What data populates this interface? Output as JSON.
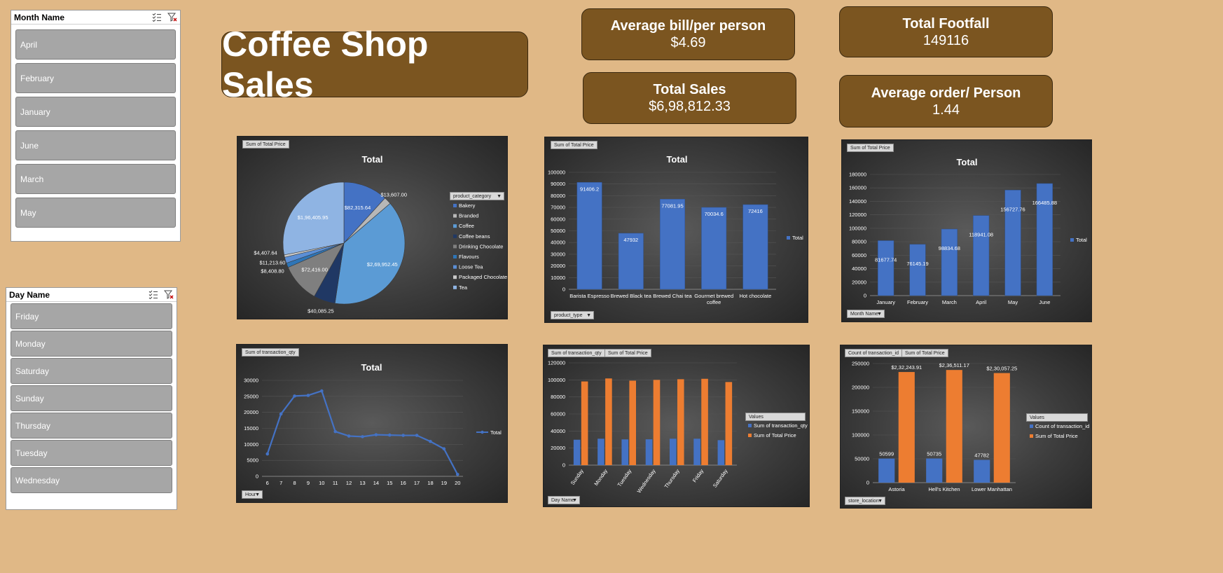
{
  "month_slicer": {
    "title": "Month Name",
    "items": [
      "April",
      "February",
      "January",
      "June",
      "March",
      "May"
    ]
  },
  "day_slicer": {
    "title": "Day Name",
    "items": [
      "Friday",
      "Monday",
      "Saturday",
      "Sunday",
      "Thursday",
      "Tuesday",
      "Wednesday"
    ]
  },
  "page_title": "Coffee Shop Sales",
  "kpis": {
    "avg_bill": {
      "label": "Average bill/per person",
      "value": "$4.69"
    },
    "total_sales": {
      "label": "Total Sales",
      "value": "$6,98,812.33"
    },
    "total_footfall": {
      "label": "Total Footfall",
      "value": "149116"
    },
    "avg_order": {
      "label": "Average order/ Person",
      "value": "1.44"
    }
  },
  "colors": {
    "blue": "#4472c4",
    "orange": "#ed7d31",
    "card": "#7b5520",
    "background": "#e0b886"
  },
  "chart_data": [
    {
      "type": "pie",
      "title": "Total",
      "field_buttons": [
        "Sum of Total Price"
      ],
      "legend_title": "product_category",
      "legend_position": "right",
      "categories": [
        "Bakery",
        "Branded",
        "Coffee",
        "Coffee beans",
        "Drinking Chocolate",
        "Flavours",
        "Loose Tea",
        "Packaged Chocolate",
        "Tea"
      ],
      "values": [
        82315.64,
        13607.0,
        269952.45,
        40085.25,
        72416.0,
        8408.8,
        11213.6,
        4407.64,
        196405.95
      ],
      "data_labels": [
        "$82,315.64",
        "$13,607.00",
        "$2,69,952.45",
        "$40,085.25",
        "$72,416.00",
        "$8,408.80",
        "$11,213.60",
        "$4,407.64",
        "$1,96,405.95"
      ],
      "slice_colors": [
        "#4472c4",
        "#b7b7b7",
        "#5b9bd5",
        "#203864",
        "#7f7f7f",
        "#2e75b6",
        "#5b8fd6",
        "#c9c9c9",
        "#8fb4e3"
      ]
    },
    {
      "type": "bar",
      "title": "Total",
      "field_buttons": [
        "Sum of Total Price"
      ],
      "axis_button": "product_type",
      "categories": [
        "Barista Espresso",
        "Brewed Black tea",
        "Brewed Chai tea",
        "Gourmet brewed coffee",
        "Hot chocolate"
      ],
      "values": [
        91406.2,
        47932,
        77081.95,
        70034.6,
        72416
      ],
      "data_labels": [
        "91406.2",
        "47932",
        "77081.95",
        "70034.6",
        "72416"
      ],
      "yticks": [
        "0",
        "10000",
        "20000",
        "30000",
        "40000",
        "50000",
        "60000",
        "70000",
        "80000",
        "90000",
        "100000"
      ],
      "ylim": [
        0,
        100000
      ],
      "legend": [
        "Total"
      ],
      "legend_position": "right"
    },
    {
      "type": "bar",
      "title": "Total",
      "field_buttons": [
        "Sum of Total Price"
      ],
      "axis_button": "Month Name",
      "categories": [
        "January",
        "February",
        "March",
        "April",
        "May",
        "June"
      ],
      "values": [
        81677.74,
        76145.19,
        98834.68,
        118941.08,
        156727.76,
        166485.88
      ],
      "data_labels": [
        "81677.74",
        "76145.19",
        "98834.68",
        "118941.08",
        "156727.76",
        "166485.88"
      ],
      "yticks": [
        "0",
        "20000",
        "40000",
        "60000",
        "80000",
        "100000",
        "120000",
        "140000",
        "160000",
        "180000"
      ],
      "ylim": [
        0,
        180000
      ],
      "legend": [
        "Total"
      ],
      "legend_position": "right"
    },
    {
      "type": "line",
      "title": "Total",
      "field_buttons": [
        "Sum of transaction_qty"
      ],
      "axis_button": "Hour",
      "x": [
        "6",
        "7",
        "8",
        "9",
        "10",
        "11",
        "12",
        "13",
        "14",
        "15",
        "16",
        "17",
        "18",
        "19",
        "20"
      ],
      "values": [
        7000,
        19500,
        25100,
        25300,
        26700,
        14000,
        12600,
        12400,
        13000,
        12900,
        12800,
        12800,
        10900,
        8600,
        600
      ],
      "yticks": [
        "0",
        "5000",
        "10000",
        "15000",
        "20000",
        "25000",
        "30000"
      ],
      "ylim": [
        0,
        30000
      ],
      "legend": [
        "Total"
      ],
      "legend_position": "right"
    },
    {
      "type": "bar",
      "field_buttons": [
        "Sum of transaction_qty",
        "Sum of Total Price"
      ],
      "axis_button": "Day Name",
      "categories": [
        "Sunday",
        "Monday",
        "Tuesday",
        "Wednesday",
        "Thursday",
        "Friday",
        "Saturday"
      ],
      "series": [
        {
          "name": "Sum of transaction_qty",
          "values": [
            29800,
            31000,
            30200,
            30300,
            31000,
            31000,
            29300
          ]
        },
        {
          "name": "Sum of Total Price",
          "values": [
            98200,
            101700,
            99100,
            100000,
            100800,
            101300,
            97500
          ]
        }
      ],
      "yticks": [
        "0",
        "20000",
        "40000",
        "60000",
        "80000",
        "100000",
        "120000"
      ],
      "ylim": [
        0,
        120000
      ],
      "legend_title": "Values",
      "legend_position": "right"
    },
    {
      "type": "bar",
      "field_buttons": [
        "Count of transaction_id",
        "Sum of Total Price"
      ],
      "axis_button": "store_location",
      "categories": [
        "Astoria",
        "Hell's Kitchen",
        "Lower Manhattan"
      ],
      "series": [
        {
          "name": "Count of transaction_id",
          "values": [
            50599,
            50735,
            47782
          ],
          "data_labels": [
            "50599",
            "50735",
            "47782"
          ]
        },
        {
          "name": "Sum of Total Price",
          "values": [
            232243.91,
            236511.17,
            230057.25
          ],
          "data_labels": [
            "$2,32,243.91",
            "$2,36,511.17",
            "$2,30,057.25"
          ]
        }
      ],
      "yticks": [
        "0",
        "50000",
        "100000",
        "150000",
        "200000",
        "250000"
      ],
      "ylim": [
        0,
        250000
      ],
      "legend_title": "Values",
      "legend_position": "right"
    }
  ]
}
